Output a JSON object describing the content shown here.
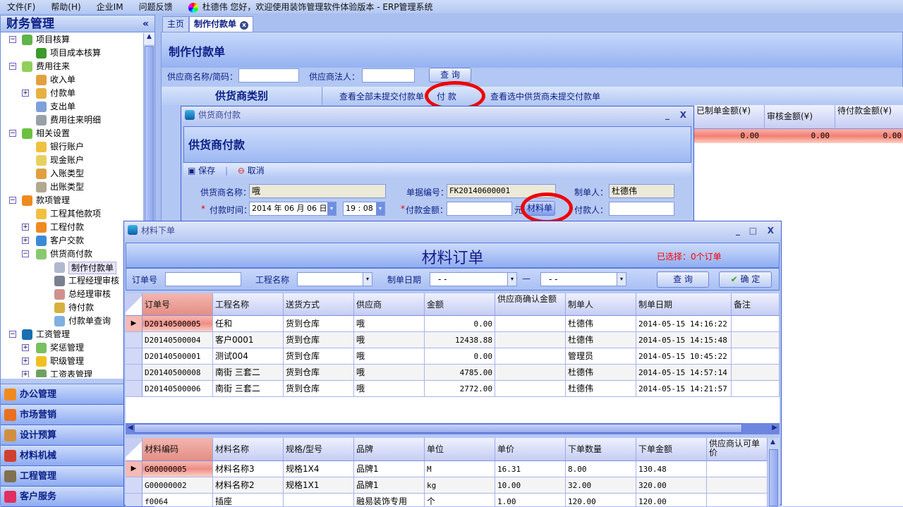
{
  "menu": {
    "items": [
      "文件(F)",
      "帮助(H)",
      "企业IM",
      "问题反馈"
    ],
    "greeting": "杜德伟  您好，欢迎使用装饰管理软件体验版本  - ERP管理系统"
  },
  "sidebar": {
    "title": "财务管理",
    "collapse": "«",
    "tree": [
      {
        "label": "项目核算",
        "level": 0,
        "exp": "-",
        "color": "#5fb44a"
      },
      {
        "label": "项目成本核算",
        "level": 1,
        "color": "#3a9a2a"
      },
      {
        "label": "费用往来",
        "level": 0,
        "exp": "-",
        "color": "#8fcf5a"
      },
      {
        "label": "收入单",
        "level": 1,
        "color": "#e0a040"
      },
      {
        "label": "付款单",
        "level": 1,
        "exp": "+",
        "color": "#e8b040"
      },
      {
        "label": "支出单",
        "level": 1,
        "color": "#7fa0d8"
      },
      {
        "label": "费用往来明细",
        "level": 1,
        "color": "#9aa0a8"
      },
      {
        "label": "相关设置",
        "level": 0,
        "exp": "-",
        "color": "#6cc040"
      },
      {
        "label": "银行账户",
        "level": 1,
        "color": "#f0c040"
      },
      {
        "label": "现金账户",
        "level": 1,
        "color": "#e8d060"
      },
      {
        "label": "入账类型",
        "level": 1,
        "color": "#e0a040"
      },
      {
        "label": "出账类型",
        "level": 1,
        "color": "#b0a890"
      },
      {
        "label": "款项管理",
        "level": 0,
        "exp": "-",
        "color": "#f08a20"
      },
      {
        "label": "工程其他款项",
        "level": 1,
        "color": "#f0c040"
      },
      {
        "label": "工程付款",
        "level": 1,
        "exp": "+",
        "color": "#f08a20"
      },
      {
        "label": "客户交款",
        "level": 1,
        "exp": "+",
        "color": "#3a8ad8"
      },
      {
        "label": "供货商付款",
        "level": 1,
        "exp": "-",
        "color": "#8ac870"
      },
      {
        "label": "制作付款单",
        "level": 2,
        "color": "#b0b8d0",
        "selected": true
      },
      {
        "label": "工程经理审核",
        "level": 2,
        "color": "#7a8090"
      },
      {
        "label": "总经理审核",
        "level": 2,
        "color": "#d09090"
      },
      {
        "label": "待付款",
        "level": 2,
        "color": "#d8b040"
      },
      {
        "label": "付款单查询",
        "level": 2,
        "color": "#80b0e0"
      },
      {
        "label": "工资管理",
        "level": 0,
        "exp": "-",
        "color": "#1a70b0"
      },
      {
        "label": "奖惩管理",
        "level": 1,
        "exp": "+",
        "color": "#7ac060"
      },
      {
        "label": "职级管理",
        "level": 1,
        "exp": "+",
        "color": "#f0c020"
      },
      {
        "label": "工资表管理",
        "level": 1,
        "exp": "+",
        "color": "#70a060"
      }
    ],
    "modules": [
      {
        "label": "办公管理",
        "color": "#f08a20"
      },
      {
        "label": "市场营销",
        "color": "#e87020"
      },
      {
        "label": "设计预算",
        "color": "#d09040"
      },
      {
        "label": "材料机械",
        "color": "#d04030"
      },
      {
        "label": "工程管理",
        "color": "#807050"
      },
      {
        "label": "客户服务",
        "color": "#e03060"
      }
    ]
  },
  "tabs": [
    {
      "label": "主页"
    },
    {
      "label": "制作付款单",
      "close": "x"
    }
  ],
  "page": {
    "title": "制作付款单",
    "supplier_name_label": "供应商名称/简码：",
    "supplier_name_value": "",
    "legal_label": "供应商法人：",
    "legal_value": "",
    "query": "查 询",
    "category": "供货商类别",
    "view_all": "查看全部未提交付款单",
    "pay": "付 款",
    "view_selected": "查看选中供货商未提交付款单",
    "summary": {
      "headers": [
        "已制单金额(¥)",
        "审核金额(¥)",
        "待付款金额(¥)"
      ],
      "values": [
        "0.00",
        "0.00",
        "0.00"
      ]
    }
  },
  "pay_dialog": {
    "title": "供货商付款",
    "header": "供货商付款",
    "save": "保存",
    "cancel": "取消",
    "supplier_label": "供货商名称：",
    "supplier_value": "哦",
    "doc_no_label": "单据编号：",
    "doc_no_value": "FK20140600001",
    "maker_label": "制单人：",
    "maker_value": "杜德伟",
    "time_label": "付款时间：",
    "date_value": "2014 年 06 月 06 日",
    "time_value": "19 : 08",
    "amount_label": "付款金额：",
    "amount_value": "",
    "unit": "元",
    "material_btn": "材料单",
    "payer_label": "付款人：",
    "payer_value": "",
    "required": "*",
    "min": "_",
    "close": "X"
  },
  "material_dialog": {
    "title": "材料下单",
    "header": "材料订单",
    "selected_text": "已选择：0个订单",
    "selected_color": "#ff0000",
    "order_no_label": "订单号",
    "order_no_value": "",
    "project_label": "工程名称",
    "project_value": "",
    "date_label": "制单日期",
    "date_from": "-  -",
    "date_to": "-  -",
    "dash": "—",
    "query": "查 询",
    "confirm": "确 定",
    "min": "_",
    "max": "□",
    "close": "X",
    "orders": {
      "headers": [
        "订单号",
        "工程名称",
        "送货方式",
        "供应商",
        "金额",
        "供应商确认金额",
        "制单人",
        "制单日期",
        "备注"
      ],
      "rows": [
        [
          "D20140500005",
          "任和",
          "货到仓库",
          "哦",
          "0.00",
          "",
          "杜德伟",
          "2014-05-15 14:16:22",
          ""
        ],
        [
          "D20140500004",
          "客户0001",
          "货到仓库",
          "哦",
          "12438.88",
          "",
          "杜德伟",
          "2014-05-15 14:15:48",
          ""
        ],
        [
          "D20140500001",
          "测试004",
          "货到仓库",
          "哦",
          "0.00",
          "",
          "管理员",
          "2014-05-15 10:45:22",
          ""
        ],
        [
          "D20140500008",
          "南街 三套二",
          "货到仓库",
          "哦",
          "4785.00",
          "",
          "杜德伟",
          "2014-05-15 14:57:14",
          ""
        ],
        [
          "D20140500006",
          "南街 三套二",
          "货到仓库",
          "哦",
          "2772.00",
          "",
          "杜德伟",
          "2014-05-15 14:21:57",
          ""
        ]
      ]
    },
    "items": {
      "headers": [
        "材料编码",
        "材料名称",
        "规格/型号",
        "品牌",
        "单位",
        "单价",
        "下单数量",
        "下单金额",
        "供应商认可单价"
      ],
      "rows": [
        [
          "G00000005",
          "材料名称3",
          "规格1X4",
          "品牌1",
          "M",
          "16.31",
          "8.00",
          "130.48",
          ""
        ],
        [
          "G00000002",
          "材料名称2",
          "规格1X1",
          "品牌1",
          "kg",
          "10.00",
          "32.00",
          "320.00",
          ""
        ],
        [
          "f0064",
          "插座",
          "",
          "融易装饰专用",
          "个",
          "1.00",
          "120.00",
          "120.00",
          ""
        ]
      ]
    }
  }
}
